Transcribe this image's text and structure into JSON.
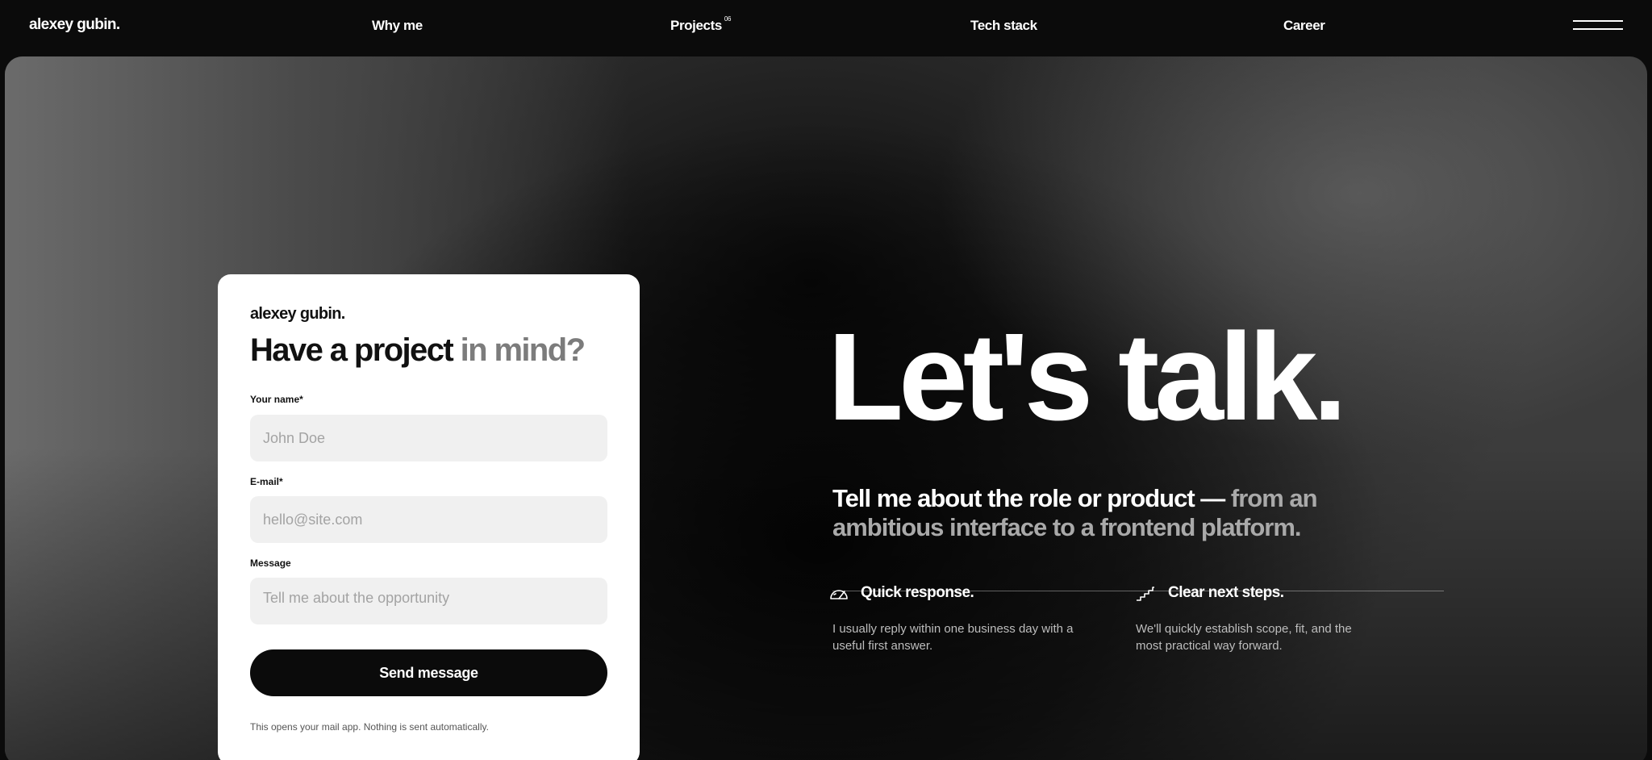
{
  "nav": {
    "logo": "alexey gubin.",
    "links": [
      {
        "label": "Why me"
      },
      {
        "label": "Projects",
        "badge": "06"
      },
      {
        "label": "Tech stack"
      },
      {
        "label": "Career"
      }
    ],
    "menu_icon": "hamburger-icon"
  },
  "form": {
    "brand": "alexey gubin.",
    "heading_main": "Have a project",
    "heading_muted": "in mind?",
    "fields": [
      {
        "label": "Your name*",
        "placeholder": "John Doe",
        "value": ""
      },
      {
        "label": "E-mail*",
        "placeholder": "hello@site.com",
        "value": ""
      },
      {
        "label": "Message",
        "placeholder": "Tell me about the opportunity",
        "value": ""
      }
    ],
    "submit_label": "Send message",
    "note": "This opens your mail app. Nothing is sent automatically."
  },
  "hero": {
    "title": "Let's talk.",
    "subtitle_main": "Tell me about the role or product —",
    "subtitle_muted": "from an ambitious interface to a frontend platform."
  },
  "features": [
    {
      "icon": "speedometer-icon",
      "title": "Quick response.",
      "text": "I usually reply within one business day with a useful first answer."
    },
    {
      "icon": "stairs-icon",
      "title": "Clear next steps.",
      "text": "We'll quickly establish scope, fit, and the most practical way forward."
    }
  ],
  "colors": {
    "page_background": "#0b0b0b",
    "card_background": "#ffffff",
    "button_background": "#0b0b0b",
    "field_background": "#f0f0f0",
    "muted_text": "#7c7c7c"
  }
}
